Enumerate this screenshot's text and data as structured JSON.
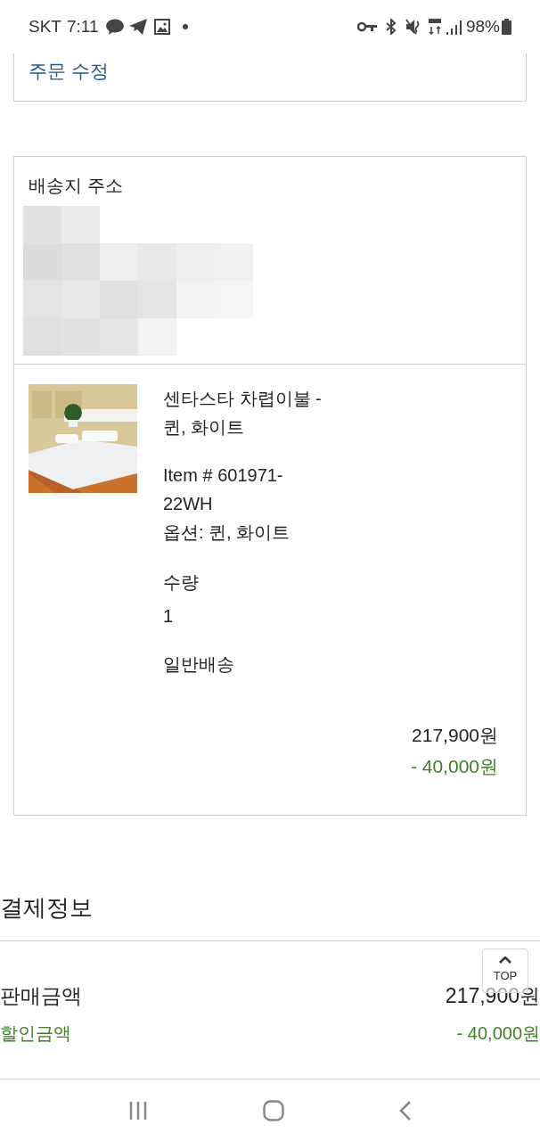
{
  "status_bar": {
    "carrier": "SKT",
    "time": "7:11",
    "battery": "98%"
  },
  "order_actions": [
    {
      "label": "주문 수정"
    }
  ],
  "shipping": {
    "title": "배송지 주소"
  },
  "item": {
    "name": "센타스타 차렵이불 - 퀸, 화이트",
    "item_no": "Item #  601971-22WH",
    "option": "옵션:  퀸, 화이트",
    "qty_label": "수량",
    "qty": "1",
    "delivery": "일반배송",
    "price": "217,900원",
    "discount": "- 40,000원"
  },
  "payment": {
    "title": "결제정보",
    "rows": [
      {
        "kind": "price",
        "label": "판매금액",
        "value": "217,900원"
      },
      {
        "kind": "discount",
        "label": "할인금액",
        "value": "- 40,000원"
      }
    ]
  },
  "top_button": {
    "label": "TOP"
  }
}
